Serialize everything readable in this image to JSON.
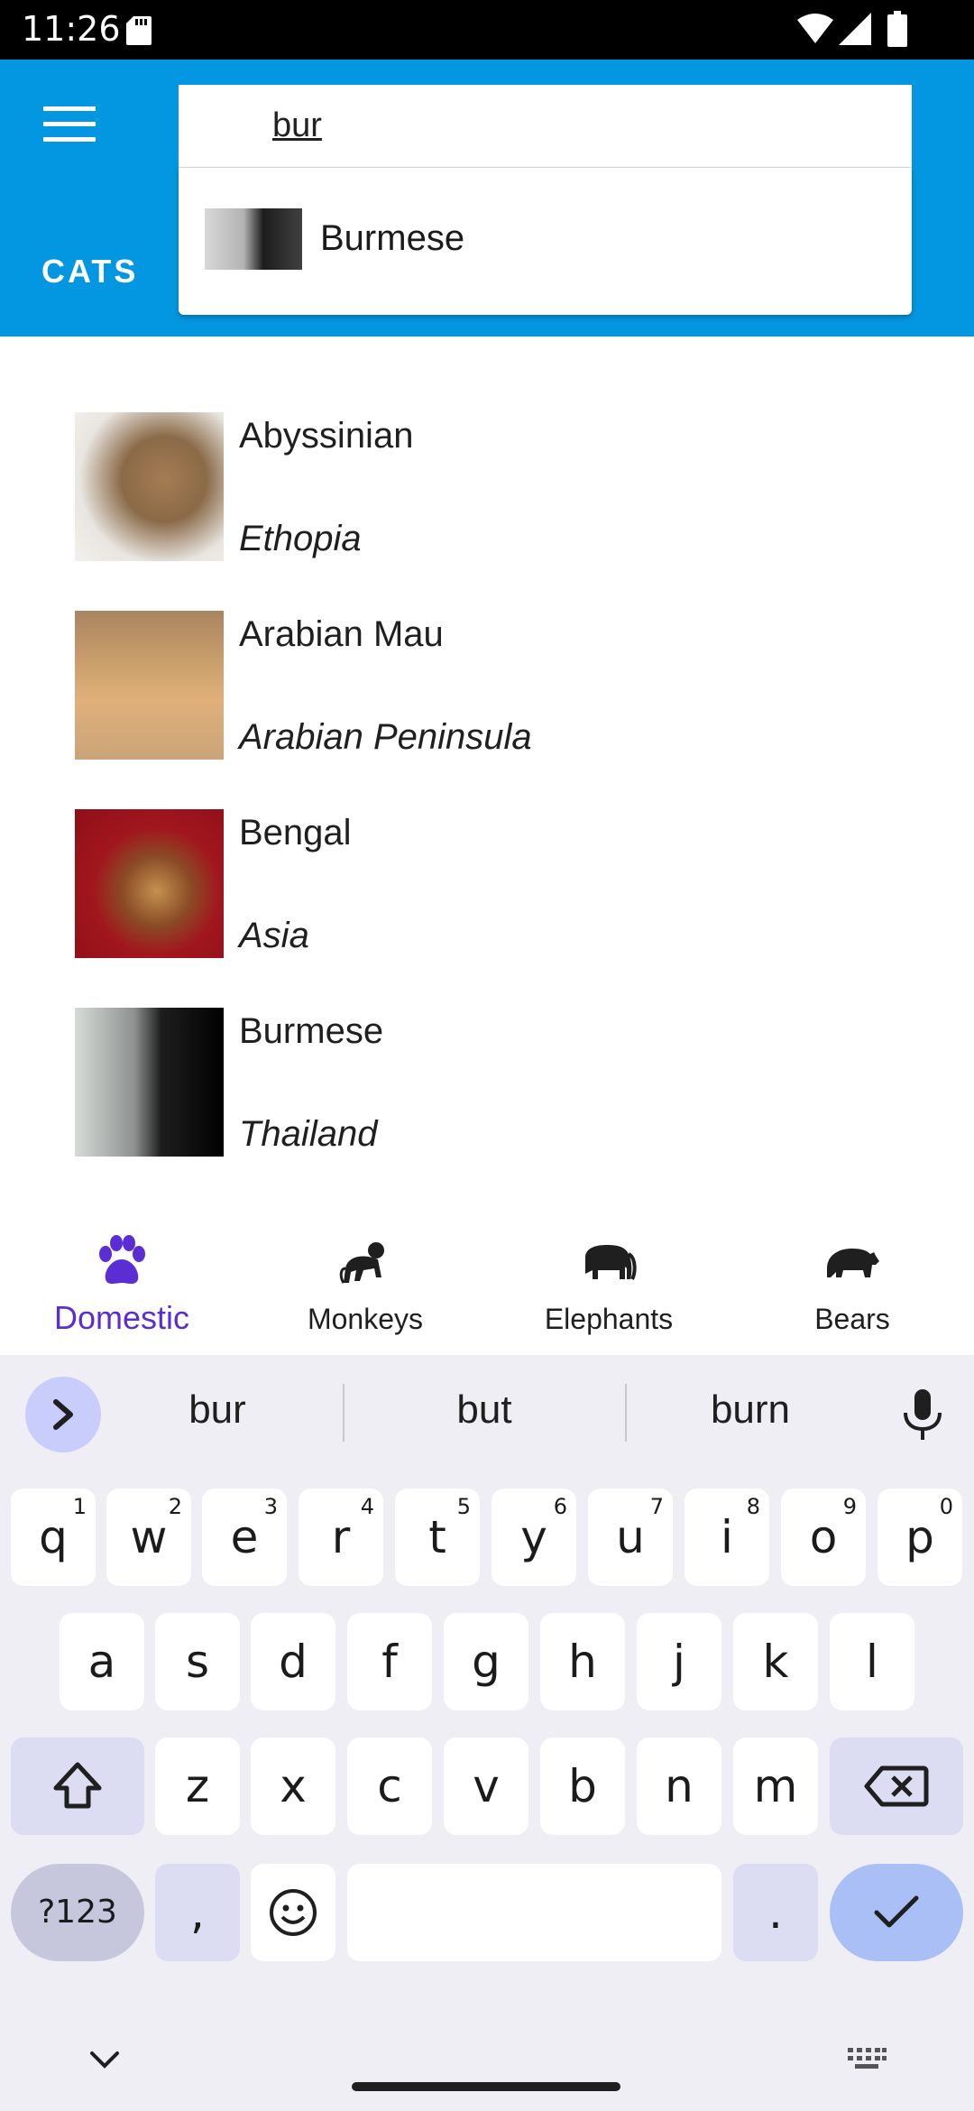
{
  "status_bar": {
    "time": "11:26"
  },
  "app_bar": {
    "menu_icon": "hamburger-menu-icon",
    "tab_label": "CATS",
    "background_color": "#0397e1"
  },
  "search": {
    "query": "bur",
    "suggestions": [
      {
        "label": "Burmese"
      }
    ]
  },
  "cat_list": [
    {
      "name": "Abyssinian",
      "origin": "Ethopia"
    },
    {
      "name": "Arabian Mau",
      "origin": "Arabian Peninsula"
    },
    {
      "name": "Bengal",
      "origin": "Asia"
    },
    {
      "name": "Burmese",
      "origin": "Thailand"
    }
  ],
  "bottom_nav": {
    "active_color": "#5b2ed4",
    "items": [
      {
        "label": "Domestic",
        "icon": "paw-icon",
        "active": true
      },
      {
        "label": "Monkeys",
        "icon": "monkey-icon",
        "active": false
      },
      {
        "label": "Elephants",
        "icon": "elephant-icon",
        "active": false
      },
      {
        "label": "Bears",
        "icon": "bear-icon",
        "active": false
      }
    ]
  },
  "keyboard": {
    "suggestions": [
      "bur",
      "but",
      "burn"
    ],
    "row1": [
      {
        "key": "q",
        "num": "1"
      },
      {
        "key": "w",
        "num": "2"
      },
      {
        "key": "e",
        "num": "3"
      },
      {
        "key": "r",
        "num": "4"
      },
      {
        "key": "t",
        "num": "5"
      },
      {
        "key": "y",
        "num": "6"
      },
      {
        "key": "u",
        "num": "7"
      },
      {
        "key": "i",
        "num": "8"
      },
      {
        "key": "o",
        "num": "9"
      },
      {
        "key": "p",
        "num": "0"
      }
    ],
    "row2": [
      "a",
      "s",
      "d",
      "f",
      "g",
      "h",
      "j",
      "k",
      "l"
    ],
    "row3": [
      "z",
      "x",
      "c",
      "v",
      "b",
      "n",
      "m"
    ],
    "symbols_label": "?123",
    "comma": ",",
    "period": "."
  }
}
